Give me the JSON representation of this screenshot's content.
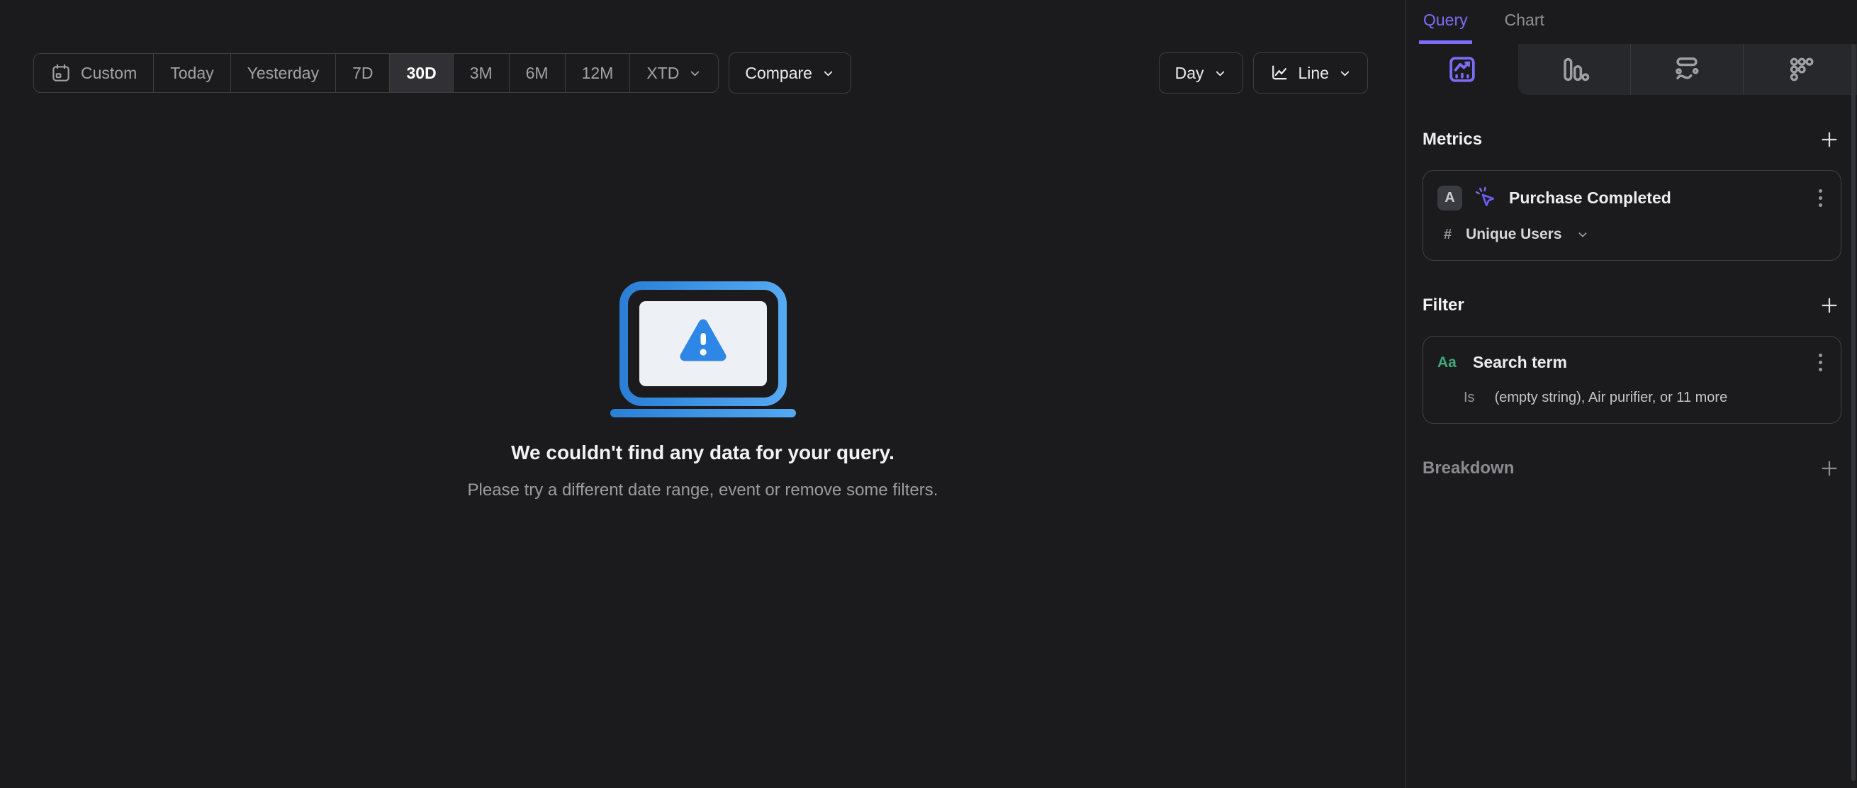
{
  "toolbar": {
    "ranges": [
      "Custom",
      "Today",
      "Yesterday",
      "7D",
      "30D",
      "3M",
      "6M",
      "12M",
      "XTD"
    ],
    "selected_range": "30D",
    "compare": "Compare",
    "granularity": "Day",
    "chart_type": "Line"
  },
  "empty_state": {
    "title": "We couldn't find any data for your query.",
    "subtitle": "Please try a different date range, event or remove some filters."
  },
  "sidebar": {
    "tabs": {
      "query": "Query",
      "chart": "Chart"
    },
    "view_tabs": [
      "insights-icon",
      "funnels-icon",
      "flows-icon",
      "more-reports-icon"
    ],
    "metrics": {
      "heading": "Metrics",
      "item": {
        "label": "A",
        "name": "Purchase Completed",
        "agg_symbol": "#",
        "aggregation": "Unique Users"
      }
    },
    "filter": {
      "heading": "Filter",
      "item": {
        "type": "Aa",
        "name": "Search term",
        "operator": "Is",
        "values": "(empty string), Air purifier, or 11 more"
      }
    },
    "breakdown": {
      "heading": "Breakdown"
    }
  },
  "colors": {
    "accent_purple": "#7d6df6",
    "property_green": "#3fa97c",
    "alert_blue": "#2e87e6",
    "background": "#1b1b1d",
    "selected_segment": "#303035"
  }
}
